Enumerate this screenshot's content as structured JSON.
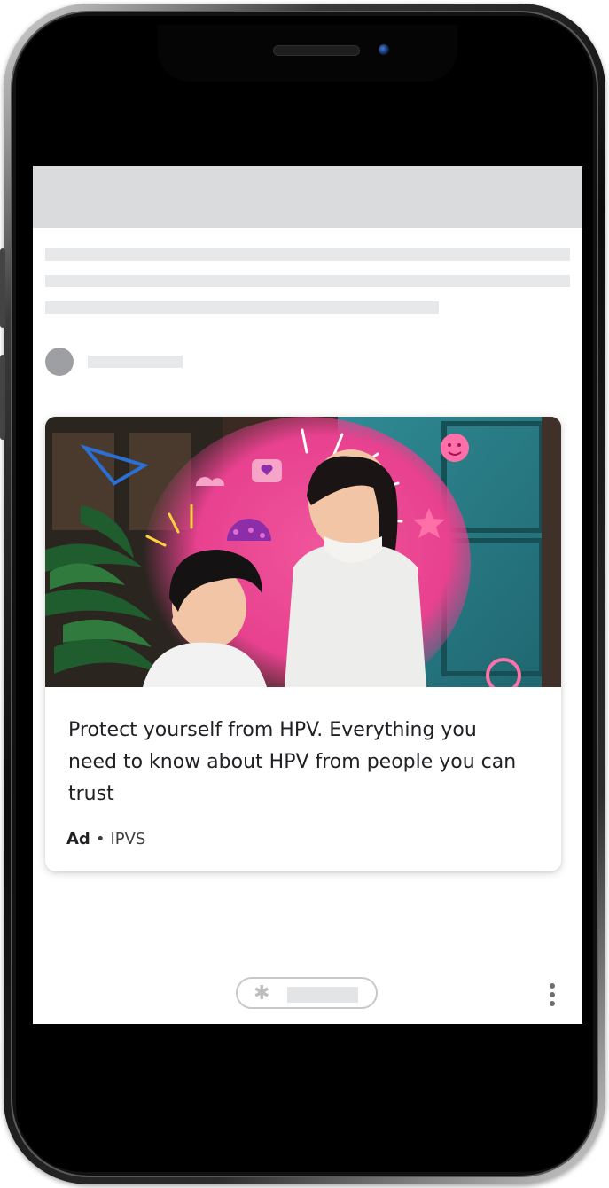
{
  "ad": {
    "headline": "Protect yourself from HPV. Everything you need to know about HPV from people you can trust",
    "label": "Ad",
    "separator": "•",
    "advertiser": "IPVS"
  },
  "icons": {
    "bottom_pill": "asterisk-icon",
    "more": "more-vert-icon"
  },
  "glyphs": {
    "asterisk": "✱"
  },
  "colors": {
    "pink": "#e8418f",
    "teal": "#2c7d86",
    "skeleton": "#e7e8ea",
    "topbar": "#dadbdc"
  }
}
